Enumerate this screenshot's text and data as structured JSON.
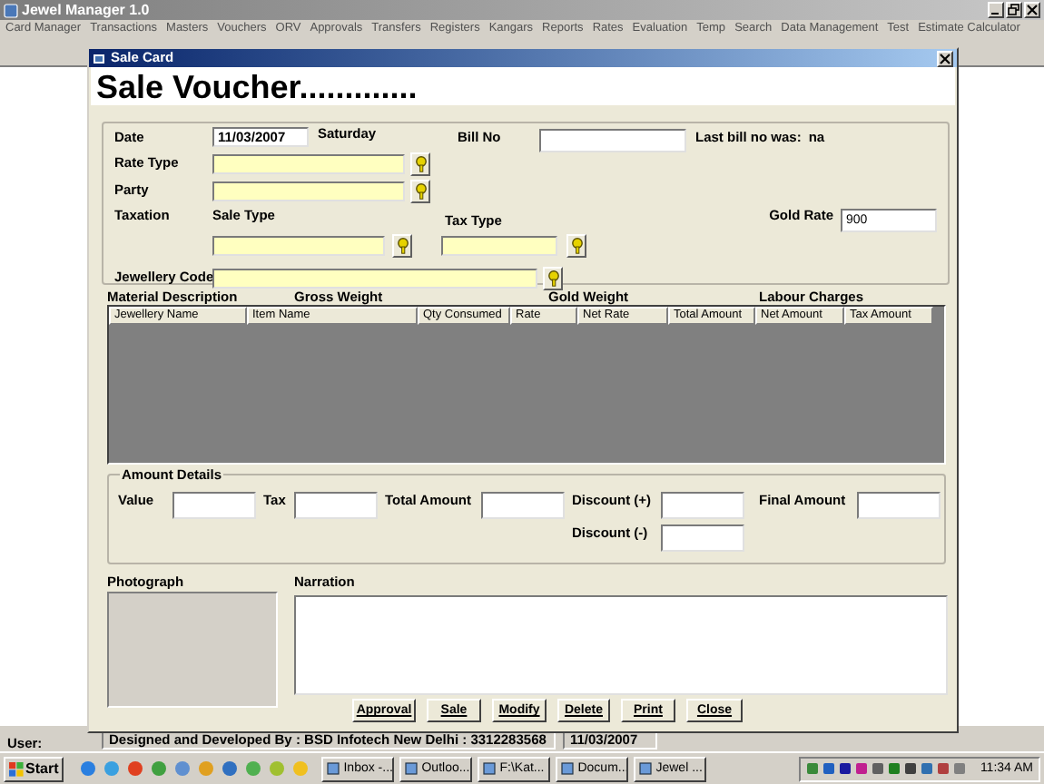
{
  "app": {
    "title": "Jewel Manager 1.0"
  },
  "menu": [
    "Card Manager",
    "Transactions",
    "Masters",
    "Vouchers",
    "ORV",
    "Approvals",
    "Transfers",
    "Registers",
    "Kangars",
    "Reports",
    "Rates",
    "Evaluation",
    "Temp",
    "Search",
    "Data Management",
    "Test",
    "Estimate Calculator"
  ],
  "dialog": {
    "title": "Sale Card",
    "heading": "Sale Voucher.............",
    "date": {
      "label": "Date",
      "value": "11/03/2007",
      "day": "Saturday"
    },
    "bill_no": {
      "label": "Bill No"
    },
    "last_bill": {
      "label": "Last bill no was:",
      "value": "na"
    },
    "rate_type": {
      "label": "Rate Type"
    },
    "party": {
      "label": "Party"
    },
    "taxation": {
      "label": "Taxation"
    },
    "sale_type": {
      "label": "Sale Type"
    },
    "tax_type": {
      "label": "Tax Type"
    },
    "gold_rate": {
      "label": "Gold Rate",
      "value": "900"
    },
    "jewellery_code": {
      "label": "Jewellery Code"
    },
    "section_labels": [
      "Material Description",
      "Gross Weight",
      "Gold Weight",
      "Labour Charges"
    ],
    "grid": {
      "columns": [
        "Jewellery Name",
        "Item Name",
        "Qty Consumed",
        "Rate",
        "Net Rate",
        "Total Amount",
        "Net Amount",
        "Tax Amount"
      ]
    },
    "amount_details": {
      "title": "Amount Details",
      "fields": [
        {
          "label": "Value"
        },
        {
          "label": "Tax"
        },
        {
          "label": "Total Amount"
        },
        {
          "label": "Discount (+)"
        },
        {
          "label": "Final Amount"
        },
        {
          "label": "Discount (-)"
        }
      ]
    },
    "photograph_label": "Photograph",
    "narration_label": "Narration",
    "buttons": [
      "Approval",
      "Sale",
      "Modify",
      "Delete",
      "Print",
      "Close"
    ]
  },
  "status_bar": {
    "user": "User:",
    "credits": "Designed and Developed By : BSD Infotech New Delhi : 3312283568",
    "date": "11/03/2007"
  },
  "taskbar": {
    "start": "Start",
    "tasks": [
      "Inbox -...",
      "Outloo...",
      "F:\\Kat...",
      "Docum...",
      "Jewel ..."
    ],
    "clock": "11:34 AM"
  }
}
